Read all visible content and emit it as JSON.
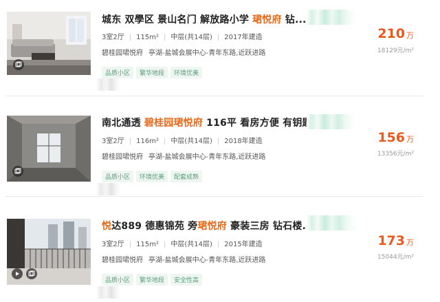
{
  "listings": [
    {
      "title_parts": [
        {
          "text": "城东 双學区 景山名门 解放路小学 ",
          "hl": false
        },
        {
          "text": "珺悦府",
          "hl": true
        },
        {
          "text": " 钻...",
          "hl": false
        }
      ],
      "meta": [
        "3室2厅",
        "115m²",
        "中层(共14层)",
        "2017年建造"
      ],
      "addr": [
        "碧桂园珺悦府",
        "亭湖-盐城会展中心-青年东路,近跃进路"
      ],
      "tags": [
        "品质小区",
        "繁华地段",
        "环境优美"
      ],
      "price": "210",
      "price_unit": "万",
      "unit_price": "18129元/m²",
      "icons": [
        "gallery-icon"
      ]
    },
    {
      "title_parts": [
        {
          "text": "南北通透 ",
          "hl": false
        },
        {
          "text": "碧桂园珺悦府",
          "hl": true
        },
        {
          "text": " 116平 看房方便 有钥匙",
          "hl": false
        }
      ],
      "meta": [
        "3室2厅",
        "116m²",
        "中层(共14层)",
        "2018年建造"
      ],
      "addr": [
        "碧桂园珺悦府",
        "亭湖-盐城会展中心-青年东路,近跃进路"
      ],
      "tags": [
        "品质小区",
        "环境优美",
        "配套成熟"
      ],
      "price": "156",
      "price_unit": "万",
      "unit_price": "13356元/m²",
      "icons": [
        "gallery-icon"
      ]
    },
    {
      "title_parts": [
        {
          "text": "悦",
          "hl": true
        },
        {
          "text": "达889 德惠锦苑 旁",
          "hl": false
        },
        {
          "text": "珺悦府",
          "hl": true
        },
        {
          "text": " 豪装三房 钻石楼...",
          "hl": false
        }
      ],
      "meta": [
        "3室2厅",
        "115m²",
        "中层(共14层)",
        "2015年建造"
      ],
      "addr": [
        "碧桂园珺悦府",
        "亭湖-盐城会展中心-青年东路,近跃进路"
      ],
      "tags": [
        "品质小区",
        "繁华地段",
        "安全性高"
      ],
      "price": "173",
      "price_unit": "万",
      "unit_price": "15044元/m²",
      "icons": [
        "play-icon",
        "gallery-icon"
      ]
    }
  ]
}
